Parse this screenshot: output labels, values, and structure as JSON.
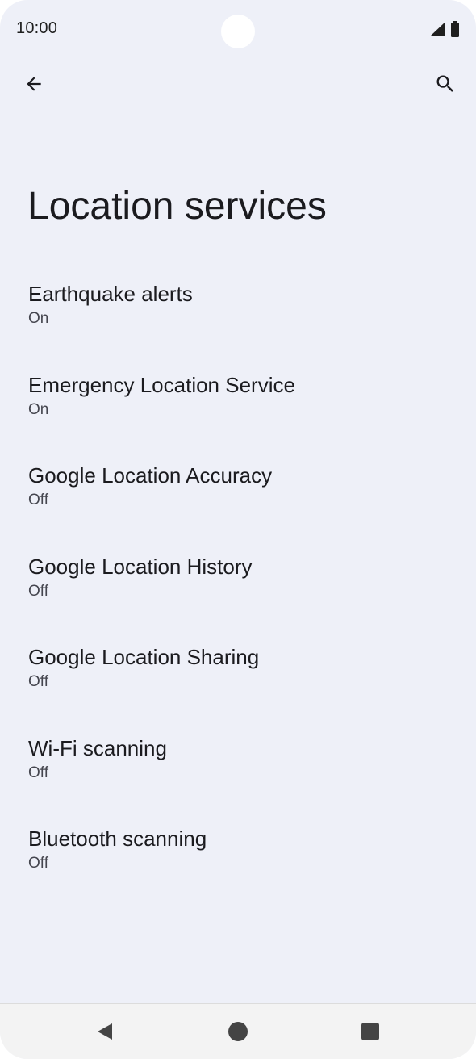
{
  "status_bar": {
    "time": "10:00"
  },
  "toolbar": {
    "back_icon": "arrow-left-icon",
    "search_icon": "search-icon"
  },
  "page": {
    "title": "Location services"
  },
  "settings": [
    {
      "title": "Earthquake alerts",
      "summary": "On"
    },
    {
      "title": "Emergency Location Service",
      "summary": "On"
    },
    {
      "title": "Google Location Accuracy",
      "summary": "Off"
    },
    {
      "title": "Google Location History",
      "summary": "Off"
    },
    {
      "title": "Google Location Sharing",
      "summary": "Off"
    },
    {
      "title": "Wi-Fi scanning",
      "summary": "Off"
    },
    {
      "title": "Bluetooth scanning",
      "summary": "Off"
    }
  ],
  "nav_bar": {
    "back_icon": "triangle-back-icon",
    "home_icon": "circle-home-icon",
    "recents_icon": "square-recents-icon"
  },
  "colors": {
    "background": "#eef0f8",
    "text_primary": "#1b1b1f",
    "text_secondary": "#45464f"
  }
}
